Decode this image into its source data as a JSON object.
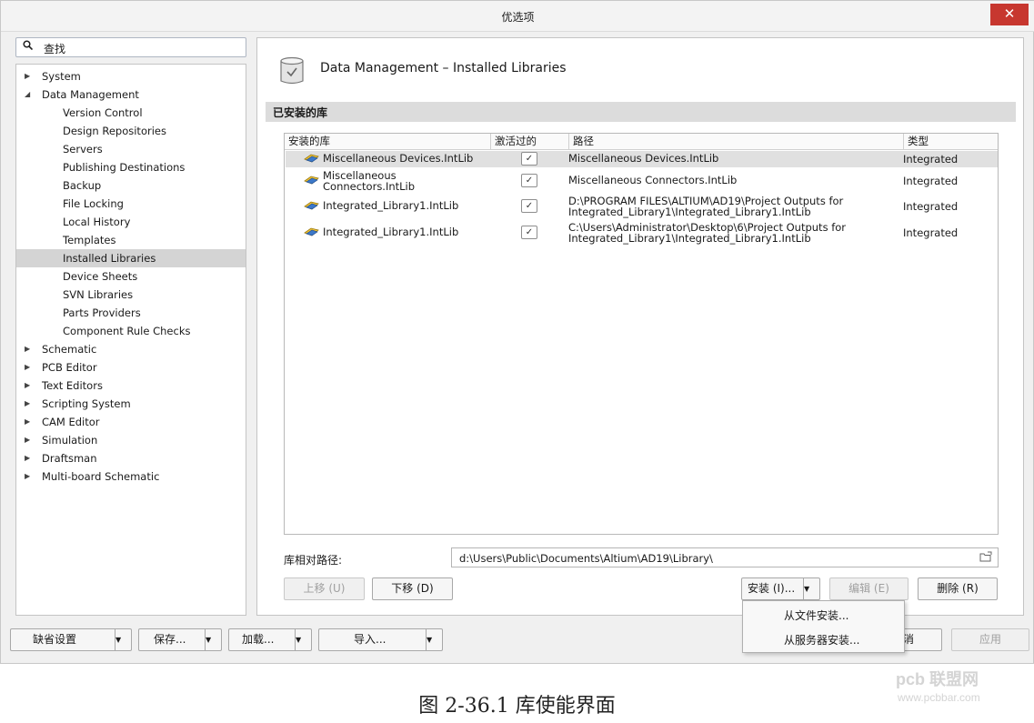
{
  "window": {
    "title": "优选项",
    "close": "✕"
  },
  "search": {
    "icon": "search-icon",
    "label": "查找"
  },
  "tree": {
    "items": [
      {
        "label": "System",
        "level": 0,
        "expanded": false
      },
      {
        "label": "Data Management",
        "level": 0,
        "expanded": true
      },
      {
        "label": "Version Control",
        "level": 1
      },
      {
        "label": "Design Repositories",
        "level": 1
      },
      {
        "label": "Servers",
        "level": 1
      },
      {
        "label": "Publishing Destinations",
        "level": 1
      },
      {
        "label": "Backup",
        "level": 1
      },
      {
        "label": "File Locking",
        "level": 1
      },
      {
        "label": "Local History",
        "level": 1
      },
      {
        "label": "Templates",
        "level": 1
      },
      {
        "label": "Installed Libraries",
        "level": 1,
        "selected": true
      },
      {
        "label": "Device Sheets",
        "level": 1
      },
      {
        "label": "SVN Libraries",
        "level": 1
      },
      {
        "label": "Parts Providers",
        "level": 1
      },
      {
        "label": "Component Rule Checks",
        "level": 1
      },
      {
        "label": "Schematic",
        "level": 0,
        "expanded": false
      },
      {
        "label": "PCB Editor",
        "level": 0,
        "expanded": false
      },
      {
        "label": "Text Editors",
        "level": 0,
        "expanded": false
      },
      {
        "label": "Scripting System",
        "level": 0,
        "expanded": false
      },
      {
        "label": "CAM Editor",
        "level": 0,
        "expanded": false
      },
      {
        "label": "Simulation",
        "level": 0,
        "expanded": false
      },
      {
        "label": "Draftsman",
        "level": 0,
        "expanded": false
      },
      {
        "label": "Multi-board Schematic",
        "level": 0,
        "expanded": false
      }
    ]
  },
  "content": {
    "heading": "Data Management – Installed Libraries",
    "section": "已安装的库",
    "table": {
      "headers": [
        "安装的库",
        "激活过的",
        "路径",
        "类型"
      ],
      "rows": [
        {
          "name1": "Miscellaneous Devices.IntLib",
          "name2": "",
          "active": true,
          "path1": "Miscellaneous Devices.IntLib",
          "path2": "",
          "type": "Integrated",
          "selected": true
        },
        {
          "name1": "Miscellaneous",
          "name2": "Connectors.IntLib",
          "active": true,
          "path1": "Miscellaneous Connectors.IntLib",
          "path2": "",
          "type": "Integrated"
        },
        {
          "name1": "Integrated_Library1.IntLib",
          "name2": "",
          "active": true,
          "path1": "D:\\PROGRAM FILES\\ALTIUM\\AD19\\Project Outputs for",
          "path2": "Integrated_Library1\\Integrated_Library1.IntLib",
          "type": "Integrated"
        },
        {
          "name1": "Integrated_Library1.IntLib",
          "name2": "",
          "active": true,
          "path1": "C:\\Users\\Administrator\\Desktop\\6\\Project Outputs for",
          "path2": "Integrated_Library1\\Integrated_Library1.IntLib",
          "type": "Integrated"
        }
      ]
    },
    "relpath_label": "库相对路径:",
    "relpath_value": "d:\\Users\\Public\\Documents\\Altium\\AD19\\Library\\",
    "buttons": {
      "move_up": "上移 (U)",
      "move_down": "下移 (D)",
      "install": "安装 (I)...",
      "edit": "编辑 (E)",
      "remove": "删除 (R)"
    },
    "install_menu": [
      "从文件安装...",
      "从服务器安装..."
    ]
  },
  "footer": {
    "defaults": "缺省设置",
    "save": "保存...",
    "load": "加载...",
    "import": "导入...",
    "cancel_partial": "消",
    "apply": "应用"
  },
  "caption": "图 2-36.1  库使能界面",
  "watermark": {
    "logo": "pcb 联盟网",
    "url": "www.pcbbar.com"
  }
}
